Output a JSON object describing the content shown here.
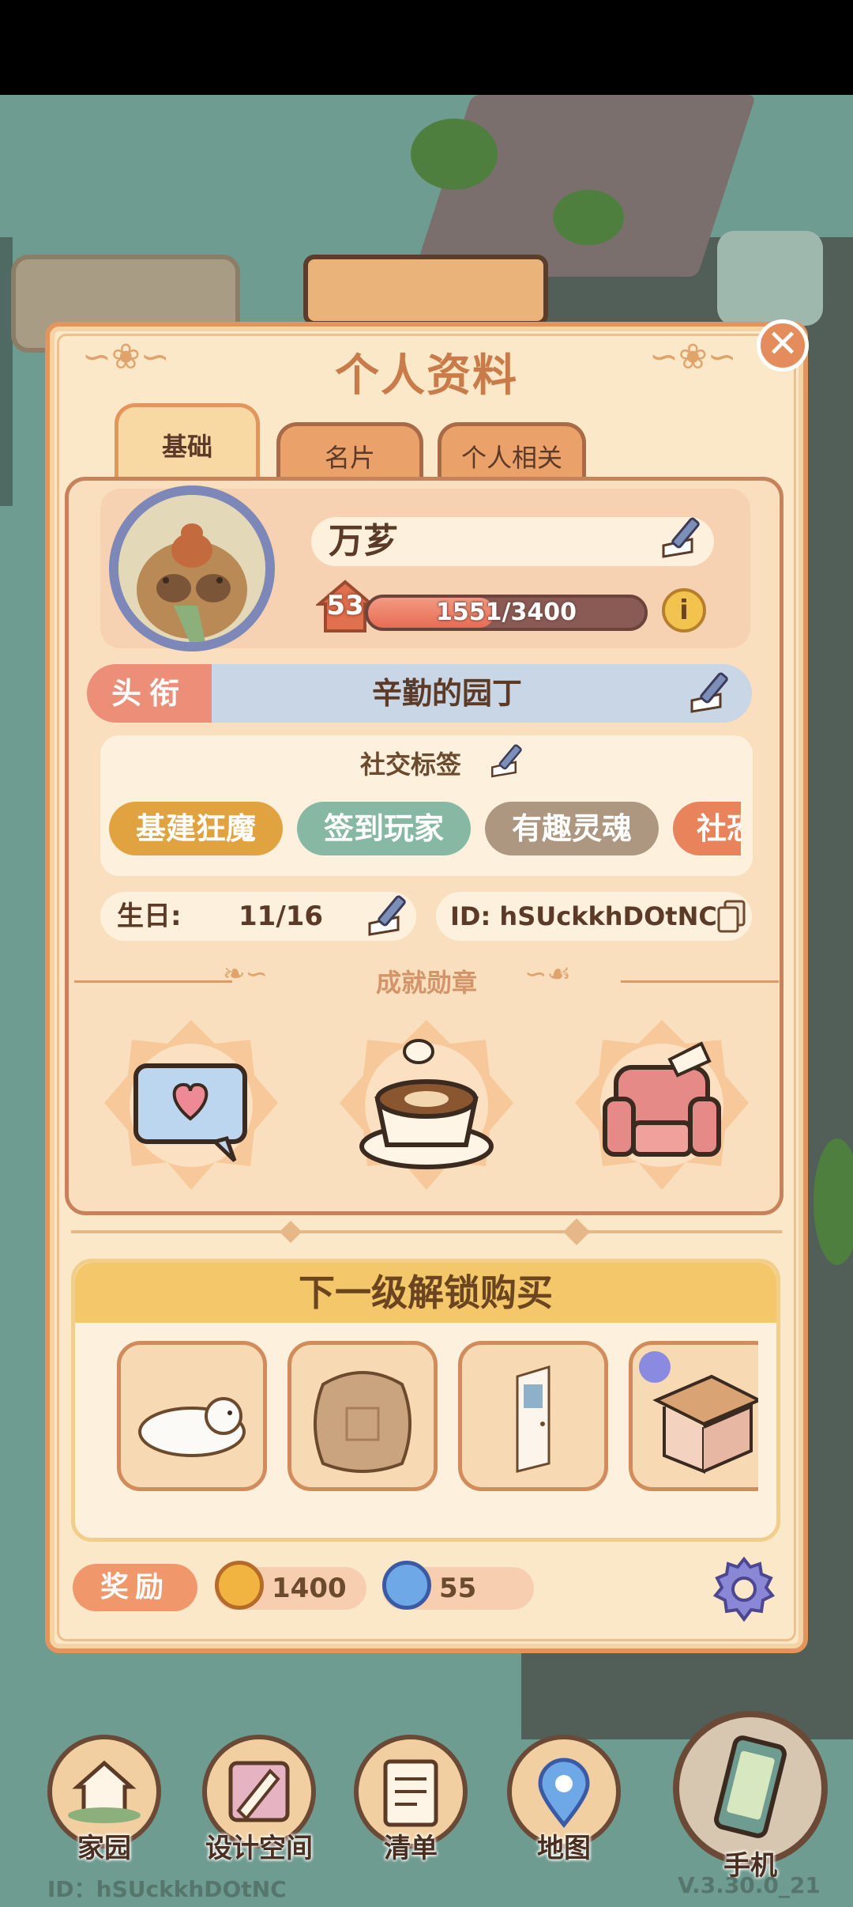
{
  "panel": {
    "title": "个人资料",
    "close_glyph": "✕"
  },
  "tabs": [
    {
      "label": "基础",
      "active": true
    },
    {
      "label": "名片",
      "active": false
    },
    {
      "label": "个人相关",
      "active": false
    }
  ],
  "profile": {
    "name": "万芗",
    "level": "53",
    "xp_text": "1551/3400",
    "xp_fraction": 0.456,
    "info_glyph": "i"
  },
  "title_row": {
    "label": "头衔",
    "value": "辛勤的园丁"
  },
  "social_tags": {
    "header": "社交标签",
    "tags": [
      {
        "label": "基建狂魔",
        "color": "#e0a33f"
      },
      {
        "label": "签到玩家",
        "color": "#86b8a4"
      },
      {
        "label": "有趣灵魂",
        "color": "#ad9780"
      },
      {
        "label": "社恐",
        "color": "#e8835b"
      }
    ]
  },
  "birthday": {
    "label": "生日:",
    "value": "11/16"
  },
  "player_id": {
    "text": "ID: hSUckkhDOtNC"
  },
  "achievements": {
    "title": "成就勋章",
    "medals": [
      "chat-heart-icon",
      "latte-coffee-icon",
      "armchair-icon"
    ]
  },
  "next_level": {
    "title": "下一级解锁购买",
    "items": [
      "polar-bear-rug-icon",
      "cushion-icon",
      "door-icon",
      "side-table-icon"
    ]
  },
  "rewards": {
    "label": "奖励",
    "coins": "1400",
    "gems": "55"
  },
  "nav": [
    {
      "label": "家园",
      "icon": "home-icon"
    },
    {
      "label": "设计空间",
      "icon": "design-icon"
    },
    {
      "label": "清单",
      "icon": "list-icon"
    },
    {
      "label": "地图",
      "icon": "map-pin-icon"
    },
    {
      "label": "手机",
      "icon": "phone-icon"
    }
  ],
  "footer": {
    "id": "ID：hSUckkhDOtNC",
    "version": "V.3.30.0_21"
  },
  "colors": {
    "panel_bg": "#fae8c8",
    "panel_border": "#e3955c",
    "title": "#c97b4a",
    "scene_bg": "#6f9c90"
  }
}
